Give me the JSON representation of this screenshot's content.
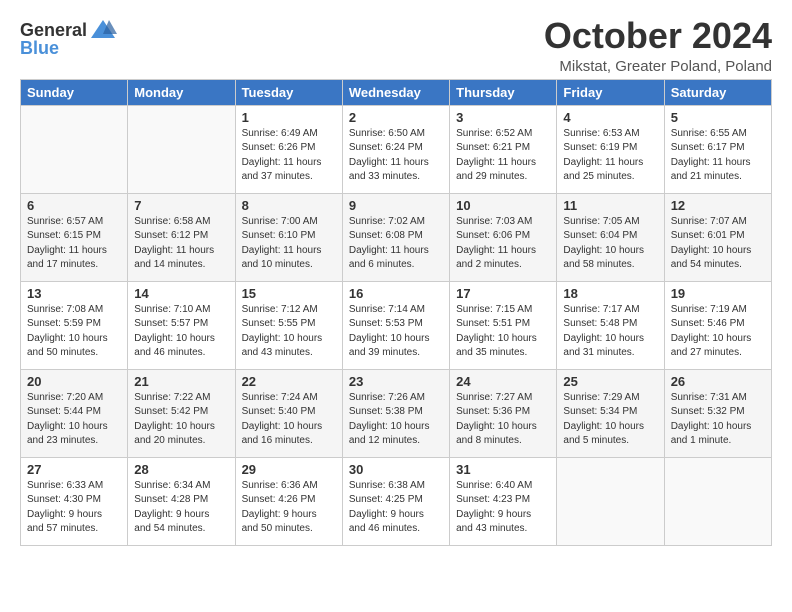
{
  "logo": {
    "general": "General",
    "blue": "Blue"
  },
  "header": {
    "month": "October 2024",
    "location": "Mikstat, Greater Poland, Poland"
  },
  "days_of_week": [
    "Sunday",
    "Monday",
    "Tuesday",
    "Wednesday",
    "Thursday",
    "Friday",
    "Saturday"
  ],
  "weeks": [
    [
      {
        "day": "",
        "info": ""
      },
      {
        "day": "",
        "info": ""
      },
      {
        "day": "1",
        "info": "Sunrise: 6:49 AM\nSunset: 6:26 PM\nDaylight: 11 hours\nand 37 minutes."
      },
      {
        "day": "2",
        "info": "Sunrise: 6:50 AM\nSunset: 6:24 PM\nDaylight: 11 hours\nand 33 minutes."
      },
      {
        "day": "3",
        "info": "Sunrise: 6:52 AM\nSunset: 6:21 PM\nDaylight: 11 hours\nand 29 minutes."
      },
      {
        "day": "4",
        "info": "Sunrise: 6:53 AM\nSunset: 6:19 PM\nDaylight: 11 hours\nand 25 minutes."
      },
      {
        "day": "5",
        "info": "Sunrise: 6:55 AM\nSunset: 6:17 PM\nDaylight: 11 hours\nand 21 minutes."
      }
    ],
    [
      {
        "day": "6",
        "info": "Sunrise: 6:57 AM\nSunset: 6:15 PM\nDaylight: 11 hours\nand 17 minutes."
      },
      {
        "day": "7",
        "info": "Sunrise: 6:58 AM\nSunset: 6:12 PM\nDaylight: 11 hours\nand 14 minutes."
      },
      {
        "day": "8",
        "info": "Sunrise: 7:00 AM\nSunset: 6:10 PM\nDaylight: 11 hours\nand 10 minutes."
      },
      {
        "day": "9",
        "info": "Sunrise: 7:02 AM\nSunset: 6:08 PM\nDaylight: 11 hours\nand 6 minutes."
      },
      {
        "day": "10",
        "info": "Sunrise: 7:03 AM\nSunset: 6:06 PM\nDaylight: 11 hours\nand 2 minutes."
      },
      {
        "day": "11",
        "info": "Sunrise: 7:05 AM\nSunset: 6:04 PM\nDaylight: 10 hours\nand 58 minutes."
      },
      {
        "day": "12",
        "info": "Sunrise: 7:07 AM\nSunset: 6:01 PM\nDaylight: 10 hours\nand 54 minutes."
      }
    ],
    [
      {
        "day": "13",
        "info": "Sunrise: 7:08 AM\nSunset: 5:59 PM\nDaylight: 10 hours\nand 50 minutes."
      },
      {
        "day": "14",
        "info": "Sunrise: 7:10 AM\nSunset: 5:57 PM\nDaylight: 10 hours\nand 46 minutes."
      },
      {
        "day": "15",
        "info": "Sunrise: 7:12 AM\nSunset: 5:55 PM\nDaylight: 10 hours\nand 43 minutes."
      },
      {
        "day": "16",
        "info": "Sunrise: 7:14 AM\nSunset: 5:53 PM\nDaylight: 10 hours\nand 39 minutes."
      },
      {
        "day": "17",
        "info": "Sunrise: 7:15 AM\nSunset: 5:51 PM\nDaylight: 10 hours\nand 35 minutes."
      },
      {
        "day": "18",
        "info": "Sunrise: 7:17 AM\nSunset: 5:48 PM\nDaylight: 10 hours\nand 31 minutes."
      },
      {
        "day": "19",
        "info": "Sunrise: 7:19 AM\nSunset: 5:46 PM\nDaylight: 10 hours\nand 27 minutes."
      }
    ],
    [
      {
        "day": "20",
        "info": "Sunrise: 7:20 AM\nSunset: 5:44 PM\nDaylight: 10 hours\nand 23 minutes."
      },
      {
        "day": "21",
        "info": "Sunrise: 7:22 AM\nSunset: 5:42 PM\nDaylight: 10 hours\nand 20 minutes."
      },
      {
        "day": "22",
        "info": "Sunrise: 7:24 AM\nSunset: 5:40 PM\nDaylight: 10 hours\nand 16 minutes."
      },
      {
        "day": "23",
        "info": "Sunrise: 7:26 AM\nSunset: 5:38 PM\nDaylight: 10 hours\nand 12 minutes."
      },
      {
        "day": "24",
        "info": "Sunrise: 7:27 AM\nSunset: 5:36 PM\nDaylight: 10 hours\nand 8 minutes."
      },
      {
        "day": "25",
        "info": "Sunrise: 7:29 AM\nSunset: 5:34 PM\nDaylight: 10 hours\nand 5 minutes."
      },
      {
        "day": "26",
        "info": "Sunrise: 7:31 AM\nSunset: 5:32 PM\nDaylight: 10 hours\nand 1 minute."
      }
    ],
    [
      {
        "day": "27",
        "info": "Sunrise: 6:33 AM\nSunset: 4:30 PM\nDaylight: 9 hours\nand 57 minutes."
      },
      {
        "day": "28",
        "info": "Sunrise: 6:34 AM\nSunset: 4:28 PM\nDaylight: 9 hours\nand 54 minutes."
      },
      {
        "day": "29",
        "info": "Sunrise: 6:36 AM\nSunset: 4:26 PM\nDaylight: 9 hours\nand 50 minutes."
      },
      {
        "day": "30",
        "info": "Sunrise: 6:38 AM\nSunset: 4:25 PM\nDaylight: 9 hours\nand 46 minutes."
      },
      {
        "day": "31",
        "info": "Sunrise: 6:40 AM\nSunset: 4:23 PM\nDaylight: 9 hours\nand 43 minutes."
      },
      {
        "day": "",
        "info": ""
      },
      {
        "day": "",
        "info": ""
      }
    ]
  ]
}
